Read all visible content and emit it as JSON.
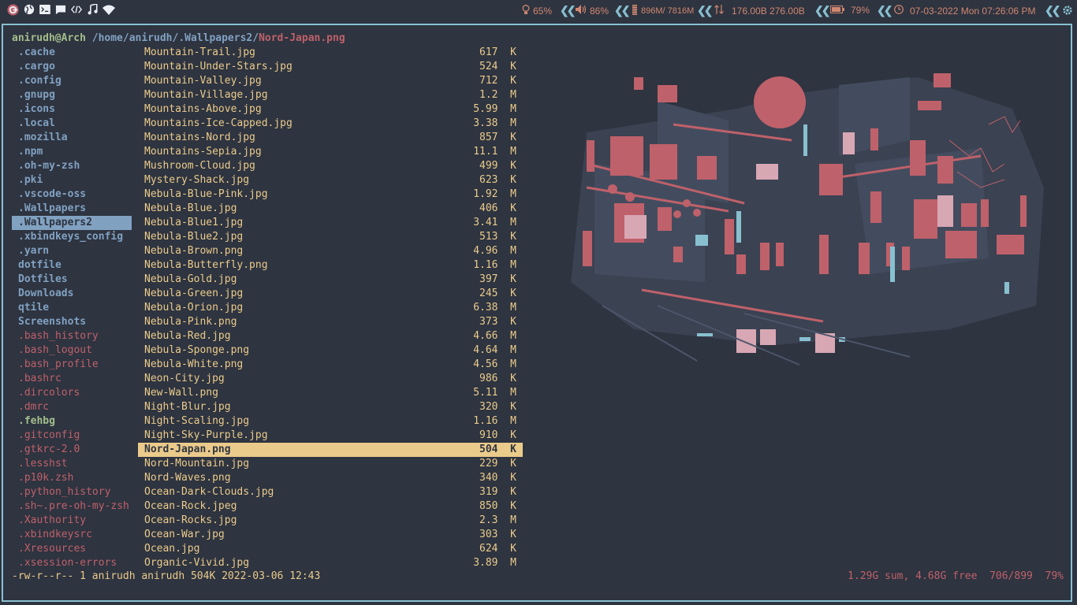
{
  "topbar": {
    "brightness": "65%",
    "volume": "86%",
    "memory": "896M/ 7816M",
    "network": "176.00B 276.00B",
    "battery": "79%",
    "datetime": "07-03-2022 Mon 07:26:06 PM"
  },
  "path": {
    "user": "anirudh@Arch",
    "dir": "/home/anirudh/.Wallpapers2/",
    "file": "Nord-Japan.png"
  },
  "left_items": [
    {
      "label": ".cache",
      "kind": "dir"
    },
    {
      "label": ".cargo",
      "kind": "dir"
    },
    {
      "label": ".config",
      "kind": "dir"
    },
    {
      "label": ".gnupg",
      "kind": "dir"
    },
    {
      "label": ".icons",
      "kind": "dir"
    },
    {
      "label": ".local",
      "kind": "dir"
    },
    {
      "label": ".mozilla",
      "kind": "dir"
    },
    {
      "label": ".npm",
      "kind": "dir"
    },
    {
      "label": ".oh-my-zsh",
      "kind": "dir"
    },
    {
      "label": ".pki",
      "kind": "dir"
    },
    {
      "label": ".vscode-oss",
      "kind": "dir"
    },
    {
      "label": ".Wallpapers",
      "kind": "dir"
    },
    {
      "label": ".Wallpapers2",
      "kind": "sel"
    },
    {
      "label": ".xbindkeys_config",
      "kind": "dir"
    },
    {
      "label": ".yarn",
      "kind": "dir"
    },
    {
      "label": "dotfile",
      "kind": "dir"
    },
    {
      "label": "Dotfiles",
      "kind": "dir"
    },
    {
      "label": "Downloads",
      "kind": "dir"
    },
    {
      "label": "qtile",
      "kind": "dir"
    },
    {
      "label": "Screenshots",
      "kind": "dir"
    },
    {
      "label": ".bash_history",
      "kind": "file"
    },
    {
      "label": ".bash_logout",
      "kind": "file"
    },
    {
      "label": ".bash_profile",
      "kind": "file"
    },
    {
      "label": ".bashrc",
      "kind": "file"
    },
    {
      "label": ".dircolors",
      "kind": "file"
    },
    {
      "label": ".dmrc",
      "kind": "file"
    },
    {
      "label": ".fehbg",
      "kind": "fileb"
    },
    {
      "label": ".gitconfig",
      "kind": "file"
    },
    {
      "label": ".gtkrc-2.0",
      "kind": "file"
    },
    {
      "label": ".lesshst",
      "kind": "file"
    },
    {
      "label": ".p10k.zsh",
      "kind": "file"
    },
    {
      "label": ".python_history",
      "kind": "file"
    },
    {
      "label": ".sh~.pre-oh-my-zsh",
      "kind": "file"
    },
    {
      "label": ".Xauthority",
      "kind": "file"
    },
    {
      "label": ".xbindkeysrc",
      "kind": "file"
    },
    {
      "label": ".Xresources",
      "kind": "file"
    },
    {
      "label": ".xsession-errors",
      "kind": "file"
    }
  ],
  "files": [
    {
      "name": "Mountain-Trail.jpg",
      "size": "617  K"
    },
    {
      "name": "Mountain-Under-Stars.jpg",
      "size": "524  K"
    },
    {
      "name": "Mountain-Valley.jpg",
      "size": "712  K"
    },
    {
      "name": "Mountain-Village.jpg",
      "size": "1.2  M"
    },
    {
      "name": "Mountains-Above.jpg",
      "size": "5.99  M"
    },
    {
      "name": "Mountains-Ice-Capped.jpg",
      "size": "3.38  M"
    },
    {
      "name": "Mountains-Nord.jpg",
      "size": "857  K"
    },
    {
      "name": "Mountains-Sepia.jpg",
      "size": "11.1  M"
    },
    {
      "name": "Mushroom-Cloud.jpg",
      "size": "499  K"
    },
    {
      "name": "Mystery-Shack.jpg",
      "size": "623  K"
    },
    {
      "name": "Nebula-Blue-Pink.jpg",
      "size": "1.92  M"
    },
    {
      "name": "Nebula-Blue.jpg",
      "size": "406  K"
    },
    {
      "name": "Nebula-Blue1.jpg",
      "size": "3.41  M"
    },
    {
      "name": "Nebula-Blue2.jpg",
      "size": "513  K"
    },
    {
      "name": "Nebula-Brown.png",
      "size": "4.96  M"
    },
    {
      "name": "Nebula-Butterfly.png",
      "size": "1.16  M"
    },
    {
      "name": "Nebula-Gold.jpg",
      "size": "397  K"
    },
    {
      "name": "Nebula-Green.jpg",
      "size": "245  K"
    },
    {
      "name": "Nebula-Orion.jpg",
      "size": "6.38  M"
    },
    {
      "name": "Nebula-Pink.png",
      "size": "373  K"
    },
    {
      "name": "Nebula-Red.jpg",
      "size": "4.66  M"
    },
    {
      "name": "Nebula-Sponge.png",
      "size": "4.64  M"
    },
    {
      "name": "Nebula-White.png",
      "size": "4.56  M"
    },
    {
      "name": "Neon-City.jpg",
      "size": "986  K"
    },
    {
      "name": "New-Wall.png",
      "size": "5.11  M"
    },
    {
      "name": "Night-Blur.jpg",
      "size": "320  K"
    },
    {
      "name": "Night-Scaling.jpg",
      "size": "1.16  M"
    },
    {
      "name": "Night-Sky-Purple.jpg",
      "size": "910  K"
    },
    {
      "name": "Nord-Japan.png",
      "size": "504  K",
      "current": true
    },
    {
      "name": "Nord-Mountain.jpg",
      "size": "229  K"
    },
    {
      "name": "Nord-Waves.png",
      "size": "340  K"
    },
    {
      "name": "Ocean-Dark-Clouds.jpg",
      "size": "319  K"
    },
    {
      "name": "Ocean-Rock.jpeg",
      "size": "850  K"
    },
    {
      "name": "Ocean-Rocks.jpg",
      "size": "2.3  M"
    },
    {
      "name": "Ocean-War.jpg",
      "size": "303  K"
    },
    {
      "name": "Ocean.jpg",
      "size": "624  K"
    },
    {
      "name": "Organic-Vivid.jpg",
      "size": "3.89  M"
    }
  ],
  "status": {
    "left": "-rw-r--r-- 1 anirudh anirudh 504K 2022-03-06 12:43",
    "right": "1.29G sum, 4.68G free  706/899  79%"
  },
  "colors": {
    "background": "#2e3440",
    "border": "#88c0d0",
    "accent_red": "#bf616a",
    "accent_yellow": "#ebcb8b",
    "accent_blue": "#81a1c1",
    "accent_green": "#a3be8c"
  }
}
